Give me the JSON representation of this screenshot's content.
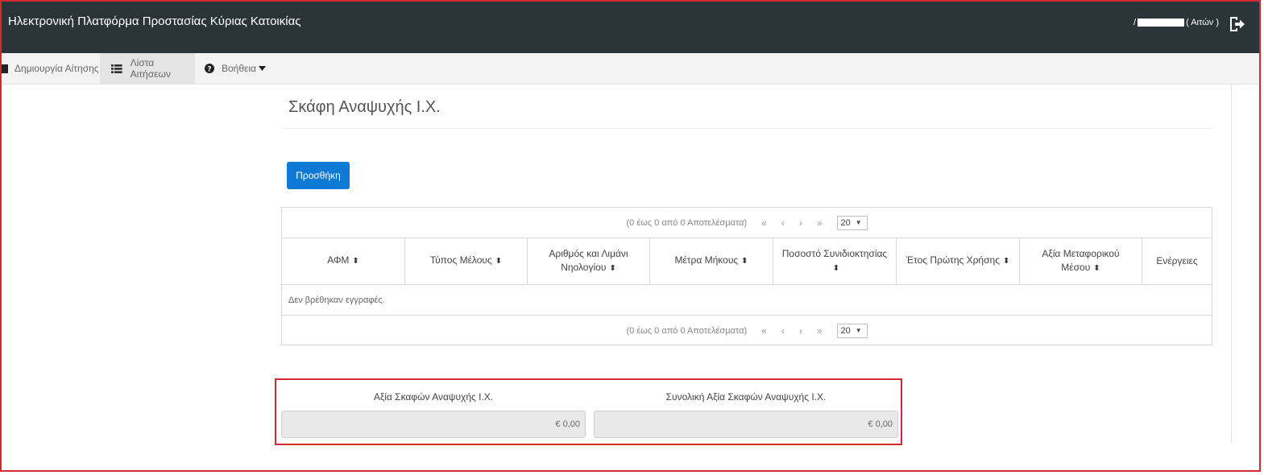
{
  "header": {
    "app_title": "Ηλεκτρονική Πλατφόρμα Προστασίας Κύριας Κατοικίας",
    "user_prefix": "/",
    "user_role": "( Αιτών )",
    "logout_icon": "sign-out-icon"
  },
  "nav": {
    "items": [
      {
        "label": "Δημιουργία Αίτησης",
        "icon": "file-icon"
      },
      {
        "label": "Λίστα Αιτήσεων",
        "icon": "list-icon"
      },
      {
        "label": "Βοήθεια",
        "icon": "question-circle-icon"
      }
    ]
  },
  "main": {
    "page_title": "Σκάφη Αναψυχής Ι.Χ.",
    "add_button": "Προσθήκη",
    "pager": {
      "report": "(0 έως 0 από 0 Αποτελέσματα)",
      "first": "«",
      "prev": "‹",
      "next": "›",
      "last": "»",
      "rows_per_page": "20"
    },
    "table": {
      "columns": [
        "ΑΦΜ",
        "Τύπος Μέλους",
        "Αριθμός και Λιμάνι Νηολογίου",
        "Μέτρα Μήκους",
        "Ποσοστό Συνιδιοκτησίας",
        "Έτος Πρώτης Χρήσης",
        "Αξία Μεταφορικού Μέσου",
        "Ενέργειες"
      ],
      "empty_message": "Δεν βρέθηκαν εγγραφές."
    },
    "summary": {
      "value_label": "Αξία Σκαφών Αναψυχής Ι.Χ.",
      "value": "€ 0,00",
      "total_label": "Συνολική Αξία Σκαφών Αναψυχής Ι.Χ.",
      "total": "€ 0,00"
    }
  },
  "colors": {
    "header_bg": "#2b3439",
    "primary_button": "#0e7ad6",
    "highlight_border": "#d3282f"
  }
}
